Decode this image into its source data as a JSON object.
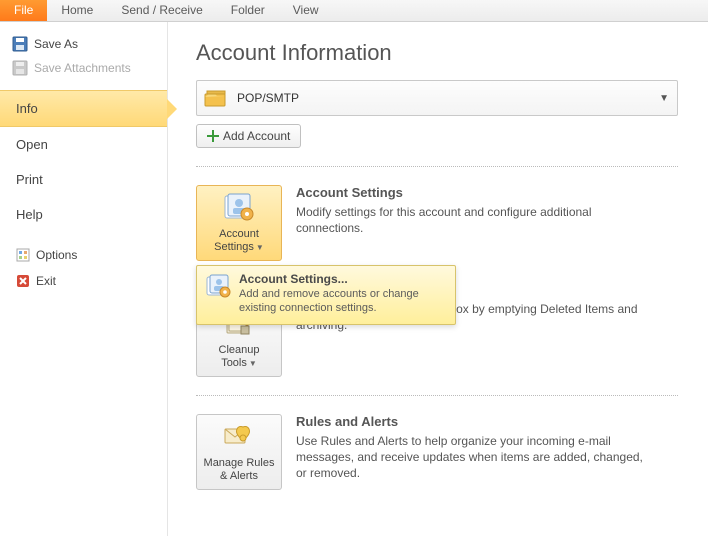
{
  "topbar": {
    "tabs": [
      "File",
      "Home",
      "Send / Receive",
      "Folder",
      "View"
    ],
    "active": 0
  },
  "sidebar": {
    "save_as": "Save As",
    "save_attachments": "Save Attachments",
    "nav": {
      "info": "Info",
      "open": "Open",
      "print": "Print",
      "help": "Help"
    },
    "options": "Options",
    "exit": "Exit"
  },
  "main": {
    "title": "Account Information",
    "account_type": "POP/SMTP",
    "add_account": "Add Account",
    "sections": {
      "account_settings": {
        "btn": "Account Settings",
        "heading": "Account Settings",
        "desc": "Modify settings for this account and configure additional connections.",
        "tooltip_title": "Account Settings...",
        "tooltip_desc": "Add and remove accounts or change existing connection settings."
      },
      "cleanup": {
        "btn": "Cleanup Tools",
        "heading_visible": "",
        "desc": "Manage the size of your mailbox by emptying Deleted Items and archiving."
      },
      "rules": {
        "btn": "Manage Rules & Alerts",
        "heading": "Rules and Alerts",
        "desc": "Use Rules and Alerts to help organize your incoming e-mail messages, and receive updates when items are added, changed, or removed."
      }
    }
  }
}
